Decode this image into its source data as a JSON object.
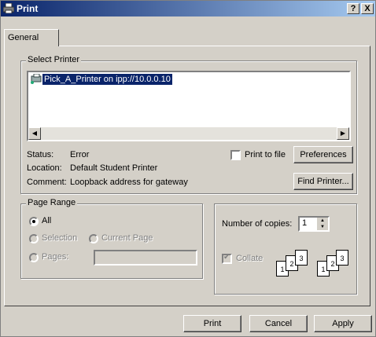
{
  "window": {
    "title": "Print",
    "help_btn": "?",
    "close_btn": "X"
  },
  "tabs": [
    {
      "label": "General"
    }
  ],
  "select_printer": {
    "legend": "Select Printer",
    "printers": [
      {
        "name": "Pick_A_Printer on ipp://10.0.0.10"
      }
    ],
    "status_label": "Status:",
    "status_value": "Error",
    "location_label": "Location:",
    "location_value": "Default Student Printer",
    "comment_label": "Comment:",
    "comment_value": "Loopback address for gateway",
    "print_to_file": "Print to file",
    "preferences": "Preferences",
    "find_printer": "Find Printer..."
  },
  "page_range": {
    "legend": "Page Range",
    "all": "All",
    "selection": "Selection",
    "current_page": "Current Page",
    "pages": "Pages:",
    "pages_value": ""
  },
  "copies": {
    "label": "Number of copies:",
    "value": "1",
    "collate": "Collate",
    "pages_a": [
      "1",
      "2",
      "3"
    ],
    "pages_b": [
      "1",
      "2",
      "3"
    ]
  },
  "buttons": {
    "print": "Print",
    "cancel": "Cancel",
    "apply": "Apply"
  }
}
